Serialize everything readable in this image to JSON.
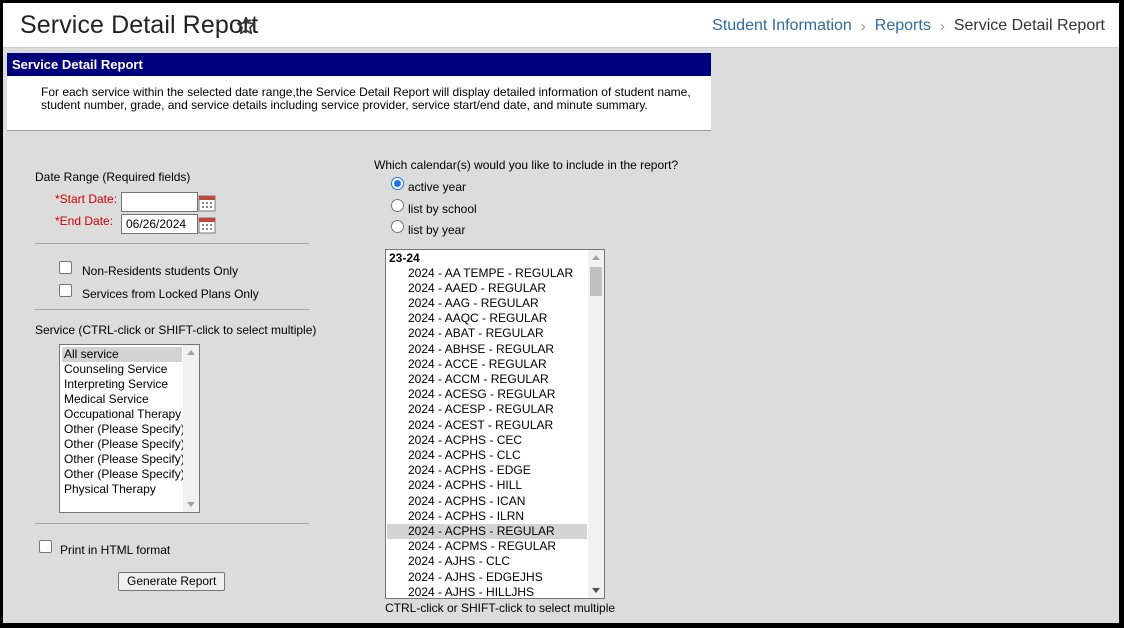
{
  "header": {
    "title": "Service Detail Report",
    "breadcrumbs": [
      "Student Information",
      "Reports",
      "Service Detail Report"
    ]
  },
  "panel": {
    "heading": "Service Detail Report",
    "description": "For each service within the selected date range,the Service Detail Report will display detailed information of student name, student number, grade, and service details including service provider, service start/end date, and minute summary."
  },
  "form": {
    "date_range_label": "Date Range (Required fields)",
    "start_date_label": "*Start Date:",
    "start_date_value": "",
    "end_date_label": "*End Date:",
    "end_date_value": "06/26/2024",
    "non_residents_label": "Non-Residents students Only",
    "non_residents_checked": false,
    "locked_plans_label": "Services from Locked Plans Only",
    "locked_plans_checked": false,
    "service_label": "Service (CTRL-click or SHIFT-click to select multiple)",
    "services": [
      "All service",
      "Counseling Service",
      "Interpreting Service",
      "Medical Service",
      "Occupational Therapy",
      "Other (Please Specify)",
      "Other (Please Specify)",
      "Other (Please Specify)",
      "Other (Please Specify)",
      "Physical Therapy"
    ],
    "selected_service": "All service",
    "print_html_label": "Print in HTML format",
    "print_html_checked": false,
    "generate_button": "Generate Report"
  },
  "calendar": {
    "question": "Which calendar(s) would you like to include in the report?",
    "options": [
      "active year",
      "list by school",
      "list by year"
    ],
    "selected_option": "active year",
    "group_label": "23-24",
    "items": [
      "2024 - AA TEMPE - REGULAR",
      "2024 - AAED - REGULAR",
      "2024 - AAG - REGULAR",
      "2024 - AAQC - REGULAR",
      "2024 - ABAT - REGULAR",
      "2024 - ABHSE - REGULAR",
      "2024 - ACCE - REGULAR",
      "2024 - ACCM - REGULAR",
      "2024 - ACESG - REGULAR",
      "2024 - ACESP - REGULAR",
      "2024 - ACEST - REGULAR",
      "2024 - ACPHS - CEC",
      "2024 - ACPHS - CLC",
      "2024 - ACPHS - EDGE",
      "2024 - ACPHS - HILL",
      "2024 - ACPHS - ICAN",
      "2024 - ACPHS - ILRN",
      "2024 - ACPHS - REGULAR",
      "2024 - ACPMS - REGULAR",
      "2024 - AJHS - CLC",
      "2024 - AJHS - EDGEJHS",
      "2024 - AJHS - HILLJHS"
    ],
    "highlighted_item": "2024 - ACPHS - REGULAR",
    "hint": "CTRL-click or SHIFT-click to select multiple"
  },
  "colors": {
    "panel_header": "#00007d",
    "required": "#cc0000",
    "breadcrumb_link": "#2f6d9e",
    "radio_selected": "#1a73e8"
  },
  "icons": [
    "star-icon",
    "calendar-icon",
    "chevron-right-icon"
  ]
}
